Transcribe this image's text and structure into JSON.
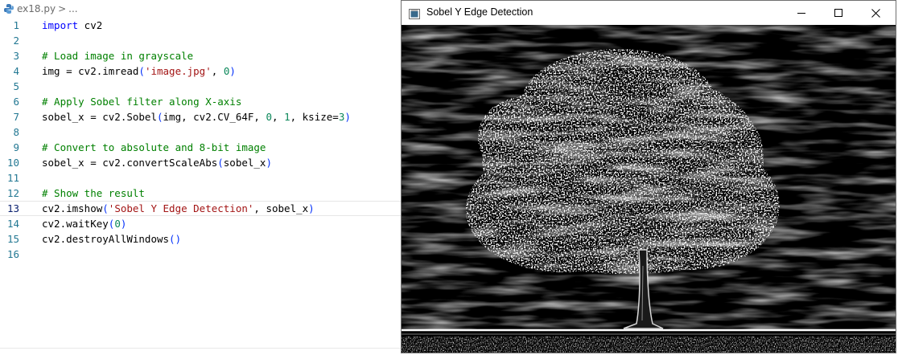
{
  "editor": {
    "breadcrumb": {
      "file": "ex18.py",
      "separator": ">",
      "more": "..."
    },
    "current_line": 13,
    "lines": [
      {
        "n": "1",
        "tokens": [
          {
            "t": "import",
            "c": "kw"
          },
          {
            "t": " cv2",
            "c": ""
          }
        ]
      },
      {
        "n": "2",
        "tokens": []
      },
      {
        "n": "3",
        "tokens": [
          {
            "t": "# Load image in grayscale",
            "c": "cm"
          }
        ]
      },
      {
        "n": "4",
        "tokens": [
          {
            "t": "img = cv2.imread",
            "c": ""
          },
          {
            "t": "(",
            "c": "pn"
          },
          {
            "t": "'image.jpg'",
            "c": "st"
          },
          {
            "t": ", ",
            "c": ""
          },
          {
            "t": "0",
            "c": "nm"
          },
          {
            "t": ")",
            "c": "pn"
          }
        ]
      },
      {
        "n": "5",
        "tokens": []
      },
      {
        "n": "6",
        "tokens": [
          {
            "t": "# Apply Sobel filter along X-axis",
            "c": "cm"
          }
        ]
      },
      {
        "n": "7",
        "tokens": [
          {
            "t": "sobel_x = cv2.Sobel",
            "c": ""
          },
          {
            "t": "(",
            "c": "pn"
          },
          {
            "t": "img, cv2.CV_64F, ",
            "c": ""
          },
          {
            "t": "0",
            "c": "nm"
          },
          {
            "t": ", ",
            "c": ""
          },
          {
            "t": "1",
            "c": "nm"
          },
          {
            "t": ", ksize=",
            "c": ""
          },
          {
            "t": "3",
            "c": "nm"
          },
          {
            "t": ")",
            "c": "pn"
          }
        ]
      },
      {
        "n": "8",
        "tokens": []
      },
      {
        "n": "9",
        "tokens": [
          {
            "t": "# Convert to absolute and 8-bit image",
            "c": "cm"
          }
        ]
      },
      {
        "n": "10",
        "tokens": [
          {
            "t": "sobel_x = cv2.convertScaleAbs",
            "c": ""
          },
          {
            "t": "(",
            "c": "pn"
          },
          {
            "t": "sobel_x",
            "c": ""
          },
          {
            "t": ")",
            "c": "pn"
          }
        ]
      },
      {
        "n": "11",
        "tokens": []
      },
      {
        "n": "12",
        "tokens": [
          {
            "t": "# Show the result",
            "c": "cm"
          }
        ]
      },
      {
        "n": "13",
        "tokens": [
          {
            "t": "cv2.imshow",
            "c": ""
          },
          {
            "t": "(",
            "c": "pn"
          },
          {
            "t": "'Sobel Y Edge Detection'",
            "c": "st"
          },
          {
            "t": ", sobel_x",
            "c": ""
          },
          {
            "t": ")",
            "c": "pn"
          }
        ]
      },
      {
        "n": "14",
        "tokens": [
          {
            "t": "cv2.waitKey",
            "c": ""
          },
          {
            "t": "(",
            "c": "pn"
          },
          {
            "t": "0",
            "c": "nm"
          },
          {
            "t": ")",
            "c": "pn"
          }
        ]
      },
      {
        "n": "15",
        "tokens": [
          {
            "t": "cv2.destroyAllWindows",
            "c": ""
          },
          {
            "t": "()",
            "c": "pn"
          }
        ]
      },
      {
        "n": "16",
        "tokens": []
      }
    ]
  },
  "window": {
    "title": "Sobel Y Edge Detection",
    "icons": {
      "app": "app-window-icon",
      "minimize": "minimize-icon",
      "maximize": "maximize-icon",
      "close": "close-icon"
    },
    "image": "sobel-edge-tree-image"
  },
  "colors": {
    "keyword": "#0000ff",
    "comment": "#008000",
    "string": "#a31515",
    "number": "#098658",
    "line_number": "#237893",
    "image_background": "#000000"
  }
}
